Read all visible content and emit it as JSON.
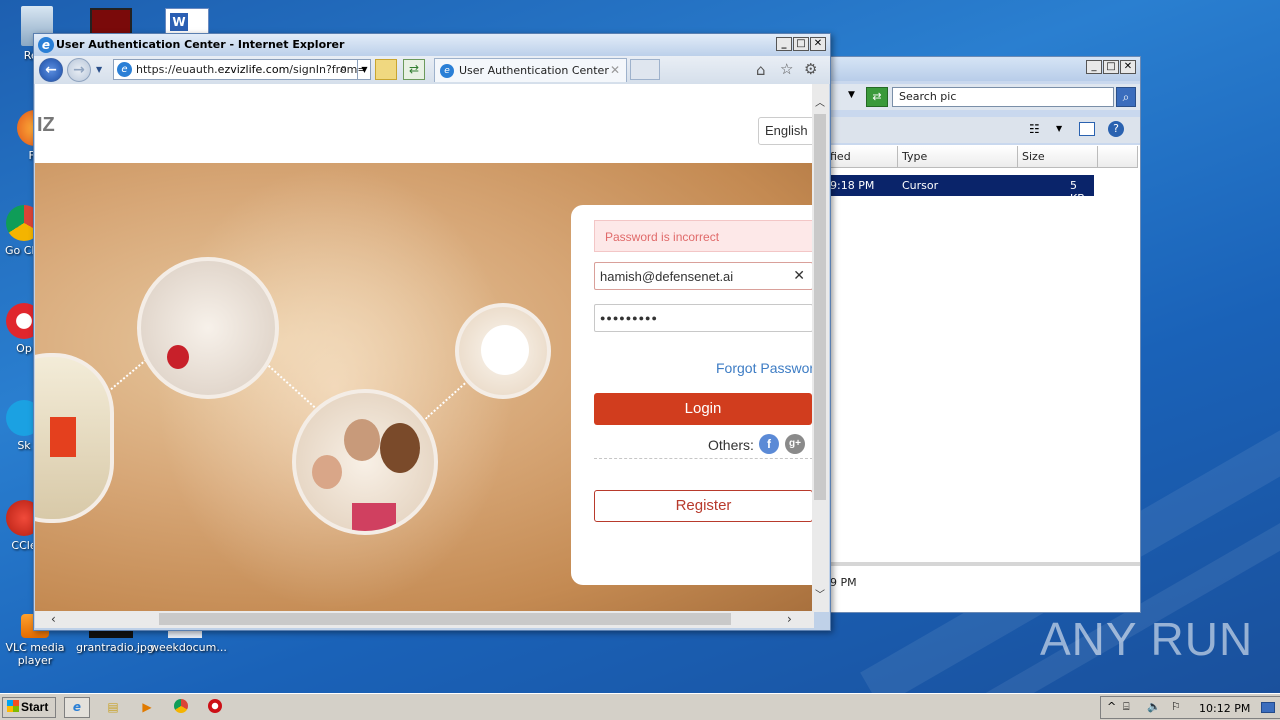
{
  "desktop": {
    "icons": [
      {
        "label": "Recy",
        "name": "recycle-bin"
      },
      {
        "label": "Fir",
        "name": "firefox"
      },
      {
        "label": "Go Chr",
        "name": "google-chrome"
      },
      {
        "label": "Op",
        "name": "opera"
      },
      {
        "label": "Sk",
        "name": "skype"
      },
      {
        "label": "CCle",
        "name": "ccleaner"
      },
      {
        "label": "VLC media player",
        "name": "vlc-media-player"
      },
      {
        "label": "grantradio.jpg",
        "name": "grantradio-jpg"
      },
      {
        "label": "weekdocum...",
        "name": "weekdocum"
      }
    ],
    "watermark": "ANY RUN"
  },
  "explorer": {
    "search_placeholder": "Search pic",
    "columns": [
      "fied",
      "Type",
      "Size"
    ],
    "selected_row": {
      "modified": "9:18 PM",
      "type": "Cursor",
      "size": "5 KB"
    },
    "details_text": "9 PM"
  },
  "ie": {
    "window_title": "User Authentication Center - Internet Explorer",
    "address_prefix": "https://euauth.",
    "address_domain": "ezvizlife.com",
    "address_suffix": "/signIn?from=",
    "tab_title": "User Authentication Center",
    "page": {
      "logo_text": "IZ",
      "language": "English",
      "error_message": "Password is incorrect",
      "email_value": "hamish@defensenet.ai",
      "password_mask": "●●●●●●●●●",
      "forgot_label": "Forgot Password",
      "login_label": "Login",
      "others_label": "Others:",
      "register_label": "Register"
    }
  },
  "taskbar": {
    "start_label": "Start",
    "clock": "10:12 PM"
  },
  "colors": {
    "login_button": "#d13d1e",
    "error_bg": "#fde8e8",
    "link": "#3d7cc4",
    "desktop_blue": "#2a7fd0"
  }
}
